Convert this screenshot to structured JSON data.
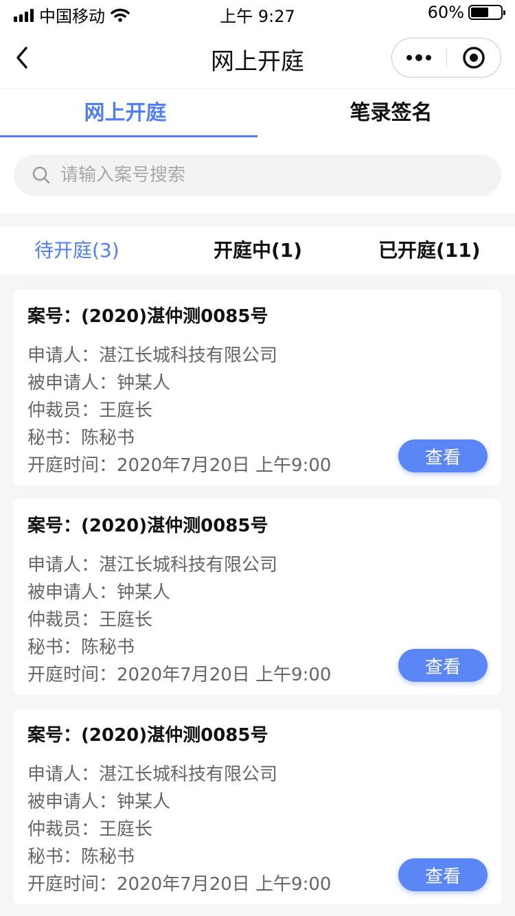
{
  "status_bar": {
    "carrier": "中国移动",
    "time": "上午 9:27",
    "battery": "60%",
    "battery_level": 0.6
  },
  "nav": {
    "title": "网上开庭"
  },
  "main_tabs": [
    {
      "label": "网上开庭",
      "active": true
    },
    {
      "label": "笔录签名",
      "active": false
    }
  ],
  "search": {
    "placeholder": "请输入案号搜索",
    "value": ""
  },
  "status_tabs": [
    {
      "label": "待开庭(3)",
      "active": true
    },
    {
      "label": "开庭中(1)",
      "active": false
    },
    {
      "label": "已开庭(11)",
      "active": false
    }
  ],
  "cases": [
    {
      "title": "案号：(2020)湛仲测0085号",
      "applicant": "申请人：湛江长城科技有限公司",
      "respondent": "被申请人：钟某人",
      "arbitrator": "仲裁员：王庭长",
      "secretary": "秘书：陈秘书",
      "hearing_time": "开庭时间：2020年7月20日 上午9:00",
      "button": "查看"
    },
    {
      "title": "案号：(2020)湛仲测0085号",
      "applicant": "申请人：湛江长城科技有限公司",
      "respondent": "被申请人：钟某人",
      "arbitrator": "仲裁员：王庭长",
      "secretary": "秘书：陈秘书",
      "hearing_time": "开庭时间：2020年7月20日 上午9:00",
      "button": "查看"
    },
    {
      "title": "案号：(2020)湛仲测0085号",
      "applicant": "申请人：湛江长城科技有限公司",
      "respondent": "被申请人：钟某人",
      "arbitrator": "仲裁员：王庭长",
      "secretary": "秘书：陈秘书",
      "hearing_time": "开庭时间：2020年7月20日 上午9:00",
      "button": "查看"
    }
  ],
  "colors": {
    "accent": "#4f7ef5",
    "button": "#5b86f5",
    "background": "#f5f6f8"
  },
  "icons": [
    "signal-icon",
    "wifi-icon",
    "battery-icon",
    "back-icon",
    "more-icon",
    "close-icon",
    "search-icon"
  ]
}
